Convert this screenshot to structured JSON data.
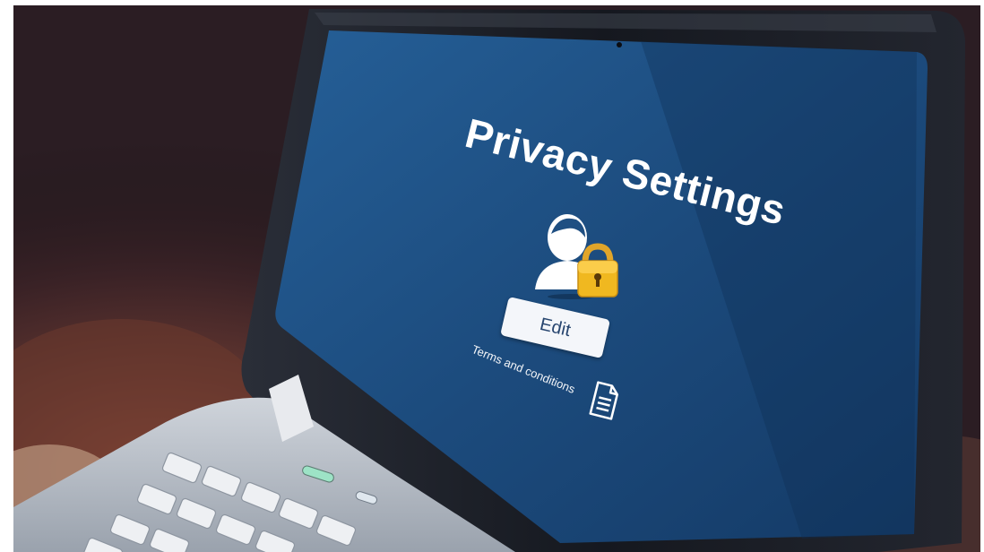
{
  "screen": {
    "title": "Privacy Settings",
    "edit_label": "Edit",
    "terms_label": "Terms and conditions",
    "icons": {
      "user": "user-icon",
      "lock": "padlock-icon",
      "document": "document-icon"
    }
  },
  "colors": {
    "screen_blue": "#1e4f82",
    "screen_blue_dark": "#12345c",
    "bezel": "#1c1f26",
    "keyboard": "#d9dde3",
    "lock_gold": "#f0b820",
    "background_dark": "#2a1c22"
  }
}
